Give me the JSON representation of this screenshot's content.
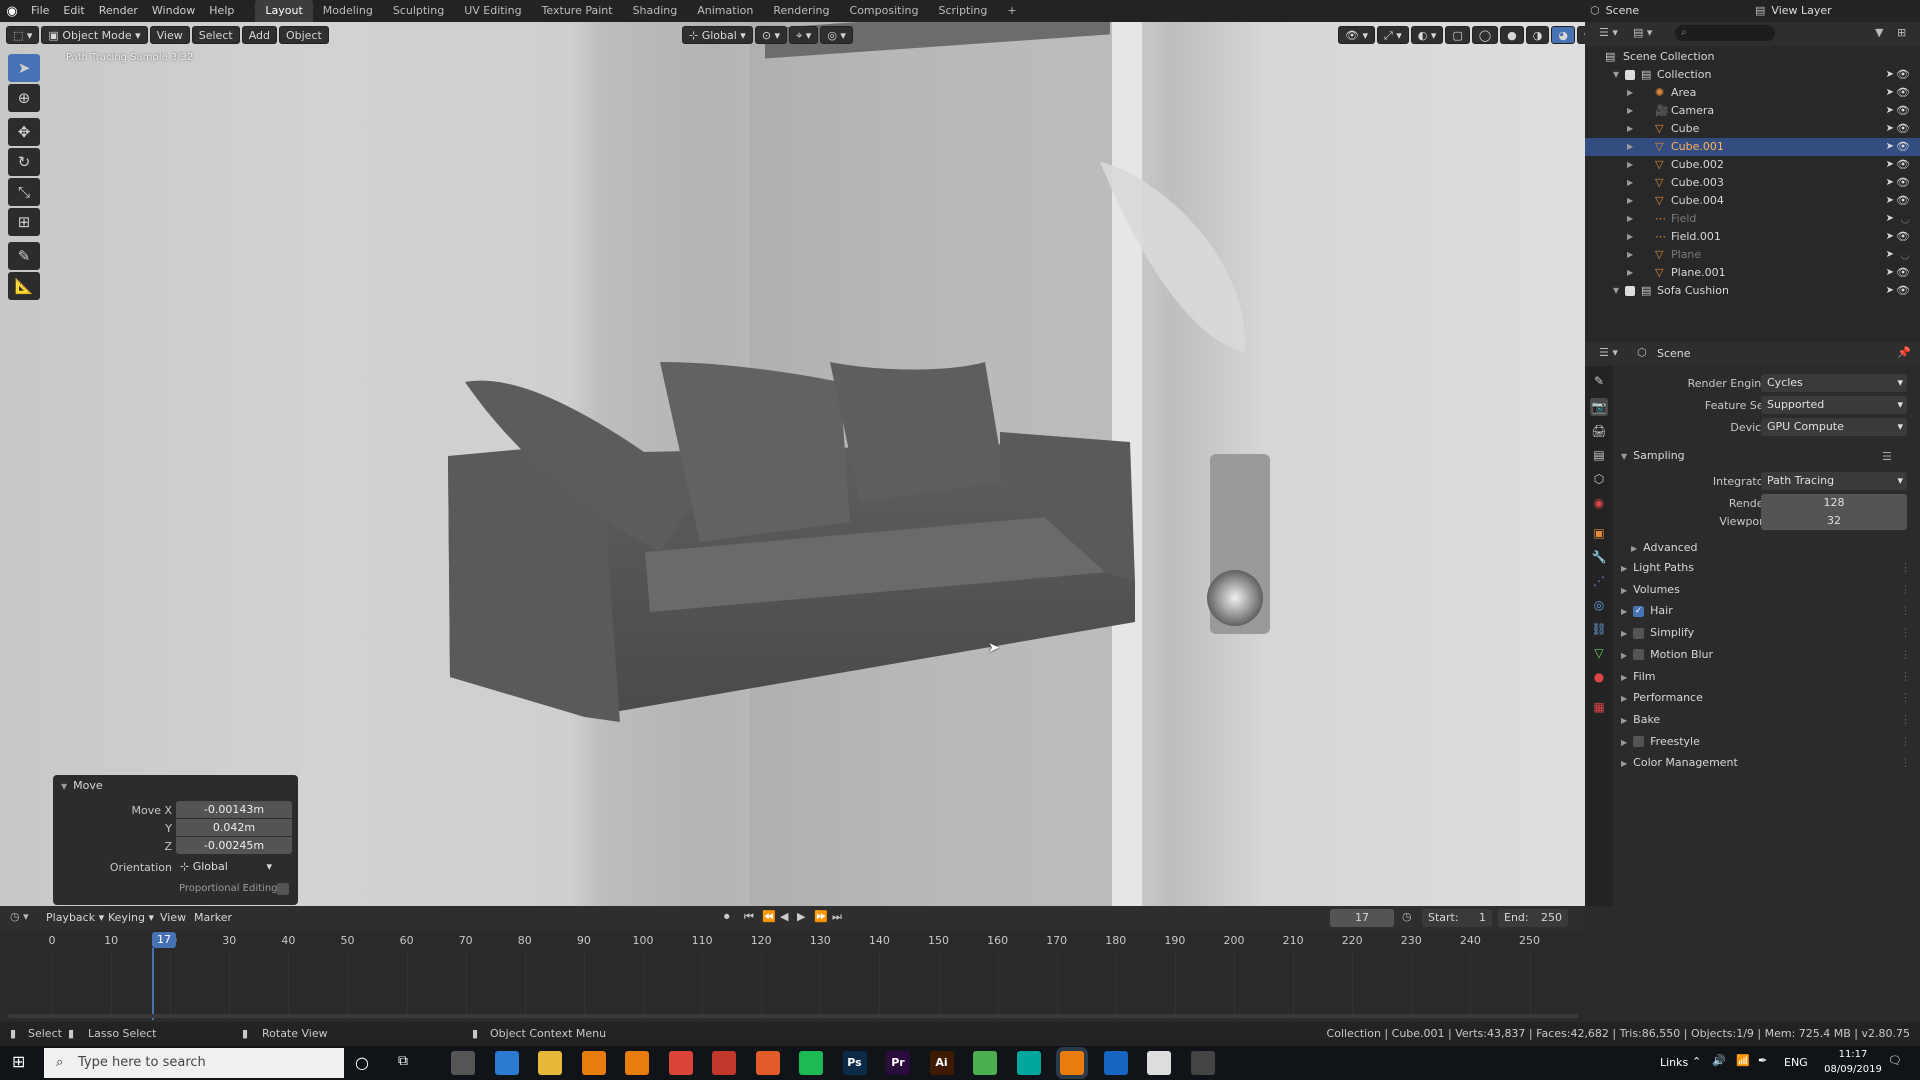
{
  "topbar": {
    "menus": [
      "File",
      "Edit",
      "Render",
      "Window",
      "Help"
    ],
    "workspaces": [
      "Layout",
      "Modeling",
      "Sculpting",
      "UV Editing",
      "Texture Paint",
      "Shading",
      "Animation",
      "Rendering",
      "Compositing",
      "Scripting"
    ],
    "active_workspace": "Layout",
    "add_tab": "+",
    "scene_label": "Scene",
    "view_layer_label": "View Layer"
  },
  "viewport": {
    "mode": "Object Mode",
    "menus": [
      "View",
      "Select",
      "Add",
      "Object"
    ],
    "orientation": "Global",
    "overlay_text": "Path Tracing Sample 3/32"
  },
  "move_panel": {
    "title": "Move",
    "move_x_label": "Move X",
    "move_x": "-0.00143m",
    "y_label": "Y",
    "y": "0.042m",
    "z_label": "Z",
    "z": "-0.00245m",
    "orientation_label": "Orientation",
    "orientation": "Global",
    "proportional_label": "Proportional Editing"
  },
  "outliner": {
    "root": "Scene Collection",
    "items": [
      {
        "name": "Collection",
        "icon": "collection-icon",
        "depth": 0
      },
      {
        "name": "Area",
        "icon": "light-icon",
        "depth": 1
      },
      {
        "name": "Camera",
        "icon": "camera-icon",
        "depth": 1
      },
      {
        "name": "Cube",
        "icon": "mesh-icon",
        "depth": 1
      },
      {
        "name": "Cube.001",
        "icon": "mesh-icon",
        "depth": 1,
        "selected": true
      },
      {
        "name": "Cube.002",
        "icon": "mesh-icon",
        "depth": 1
      },
      {
        "name": "Cube.003",
        "icon": "mesh-icon",
        "depth": 1
      },
      {
        "name": "Cube.004",
        "icon": "mesh-icon",
        "depth": 1
      },
      {
        "name": "Field",
        "icon": "field-icon",
        "depth": 1,
        "dim": true
      },
      {
        "name": "Field.001",
        "icon": "field-icon",
        "depth": 1
      },
      {
        "name": "Plane",
        "icon": "mesh-icon",
        "depth": 1,
        "dim": true
      },
      {
        "name": "Plane.001",
        "icon": "mesh-icon",
        "depth": 1
      },
      {
        "name": "Sofa Cushion",
        "icon": "collection-icon",
        "depth": 0
      }
    ]
  },
  "properties": {
    "context": "Scene",
    "render_engine_label": "Render Engine",
    "render_engine": "Cycles",
    "feature_set_label": "Feature Set",
    "feature_set": "Supported",
    "device_label": "Device",
    "device": "GPU Compute",
    "sampling": "Sampling",
    "integrator_label": "Integrator",
    "integrator": "Path Tracing",
    "render_label": "Render",
    "render": "128",
    "viewport_label": "Viewport",
    "viewport": "32",
    "advanced": "Advanced",
    "sections": [
      {
        "name": "Light Paths"
      },
      {
        "name": "Volumes"
      },
      {
        "name": "Hair",
        "check": true
      },
      {
        "name": "Simplify",
        "check": false
      },
      {
        "name": "Motion Blur",
        "check": false
      },
      {
        "name": "Film"
      },
      {
        "name": "Performance"
      },
      {
        "name": "Bake"
      },
      {
        "name": "Freestyle",
        "check": false
      },
      {
        "name": "Color Management"
      }
    ]
  },
  "timeline": {
    "menus": [
      "Playback",
      "Keying",
      "View",
      "Marker"
    ],
    "current_frame": "17",
    "start_label": "Start:",
    "start": "1",
    "end_label": "End:",
    "end": "250",
    "ticks": [
      "0",
      "10",
      "20",
      "30",
      "40",
      "50",
      "60",
      "70",
      "80",
      "90",
      "100",
      "110",
      "120",
      "130",
      "140",
      "150",
      "160",
      "170",
      "180",
      "190",
      "200",
      "210",
      "220",
      "230",
      "240",
      "250"
    ],
    "playhead": "17"
  },
  "statusbar": {
    "select": "Select",
    "lasso": "Lasso Select",
    "rotate": "Rotate View",
    "context_menu": "Object Context Menu",
    "stats": "Collection | Cube.001 | Verts:43,837 | Faces:42,682 | Tris:86,550 | Objects:1/9 | Mem: 725.4 MB | v2.80.75"
  },
  "taskbar": {
    "search_placeholder": "Type here to search",
    "links": "Links",
    "lang": "ENG",
    "time": "11:17",
    "date": "08/09/2019",
    "apps": [
      "calculator",
      "edge",
      "explorer",
      "blender",
      "blender",
      "chrome",
      "app-red",
      "app-orange",
      "media-player",
      "Ps",
      "Pr",
      "Ai",
      "app-green",
      "app-cyan",
      "blender-active",
      "app-blue",
      "photos",
      "app-circle"
    ]
  }
}
